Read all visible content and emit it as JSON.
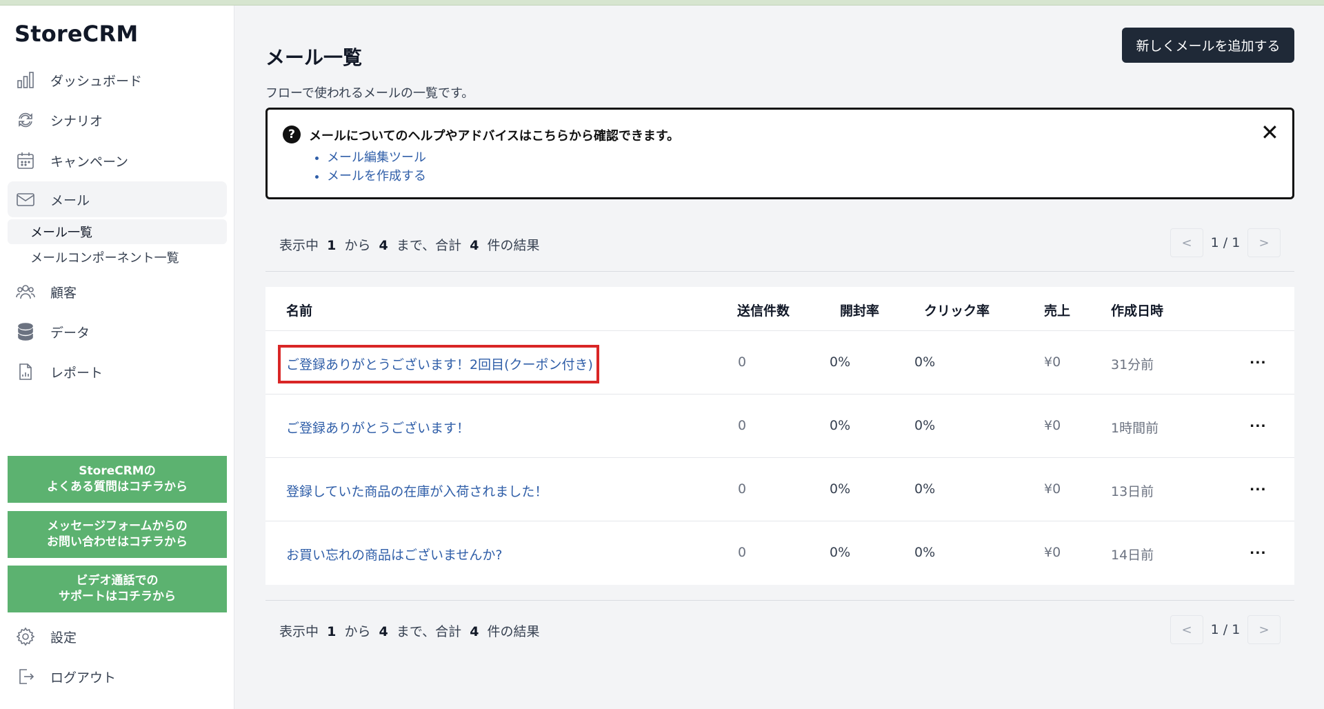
{
  "app": {
    "logo": "StoreCRM"
  },
  "sidebar": {
    "items": [
      {
        "label": "ダッシュボード",
        "icon": "bar-chart-icon"
      },
      {
        "label": "シナリオ",
        "icon": "refresh-icon"
      },
      {
        "label": "キャンペーン",
        "icon": "calendar-icon"
      },
      {
        "label": "メール",
        "icon": "mail-icon"
      },
      {
        "label": "顧客",
        "icon": "users-icon"
      },
      {
        "label": "データ",
        "icon": "database-icon"
      },
      {
        "label": "レポート",
        "icon": "report-icon"
      }
    ],
    "mail_sub": [
      {
        "label": "メール一覧"
      },
      {
        "label": "メールコンポーネント一覧"
      }
    ],
    "help_buttons": [
      {
        "line1": "StoreCRMの",
        "line2": "よくある質問はコチラから"
      },
      {
        "line1": "メッセージフォームからの",
        "line2": "お問い合わせはコチラから"
      },
      {
        "line1": "ビデオ通話での",
        "line2": "サポートはコチラから"
      }
    ],
    "settings": {
      "label": "設定",
      "icon": "gear-icon"
    },
    "logout": {
      "label": "ログアウト",
      "icon": "logout-icon"
    }
  },
  "main": {
    "title": "メール一覧",
    "description": "フローで使われるメールの一覧です。",
    "add_button": "新しくメールを追加する",
    "help": {
      "title": "メールについてのヘルプやアドバイスはこちらから確認できます。",
      "links": [
        "メール編集ツール",
        "メールを作成する"
      ],
      "close": "✕"
    },
    "results": {
      "prefix": "表示中",
      "from": "1",
      "kara": "から",
      "to": "4",
      "made": "まで、合計",
      "total": "4",
      "suffix": "件の結果"
    },
    "pagination": {
      "prev": "<",
      "current": "1 / 1",
      "next": ">"
    },
    "table": {
      "headers": [
        "名前",
        "送信件数",
        "開封率",
        "クリック率",
        "売上",
        "作成日時"
      ],
      "rows": [
        {
          "name": "ご登録ありがとうございます！2回目(クーポン付き)",
          "sent": "0",
          "open": "0%",
          "click": "0%",
          "sales": "¥0",
          "created": "31分前",
          "menu": "..."
        },
        {
          "name": "ご登録ありがとうございます！",
          "sent": "0",
          "open": "0%",
          "click": "0%",
          "sales": "¥0",
          "created": "1時間前",
          "menu": "..."
        },
        {
          "name": "登録していた商品の在庫が入荷されました！",
          "sent": "0",
          "open": "0%",
          "click": "0%",
          "sales": "¥0",
          "created": "13日前",
          "menu": "..."
        },
        {
          "name": "お買い忘れの商品はございませんか?",
          "sent": "0",
          "open": "0%",
          "click": "0%",
          "sales": "¥0",
          "created": "14日前",
          "menu": "..."
        }
      ]
    }
  },
  "colors": {
    "accent_green": "#5cb270",
    "link_blue": "#2f5ea8",
    "dark_button": "#1f2937",
    "highlight_red": "#d92626"
  }
}
